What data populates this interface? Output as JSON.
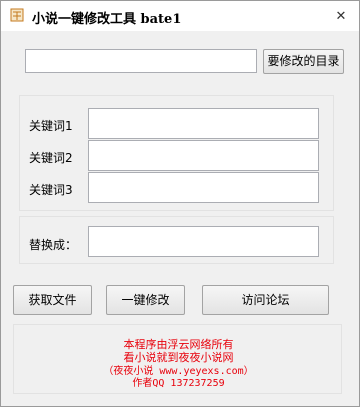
{
  "window": {
    "title": "小说一键修改工具 bate1",
    "app_icon": "book-icon",
    "close_glyph": "✕"
  },
  "directory": {
    "path_value": "",
    "browse_button": "要修改的目录"
  },
  "keywords": {
    "items": [
      {
        "label": "关键词1",
        "value": ""
      },
      {
        "label": "关键词2",
        "value": ""
      },
      {
        "label": "关键词3",
        "value": ""
      }
    ]
  },
  "replace": {
    "label": "替换成：",
    "value": ""
  },
  "actions": {
    "get_files": "获取文件",
    "one_click_modify": "一键修改",
    "visit_forum": "访问论坛"
  },
  "footer": {
    "line1": "本程序由浮云网络所有",
    "line2": "看小说就到夜夜小说网",
    "line3": "（夜夜小说  www.yeyexs.com）",
    "line4": "作者QQ  137237259",
    "text_color": "#e8000b"
  }
}
